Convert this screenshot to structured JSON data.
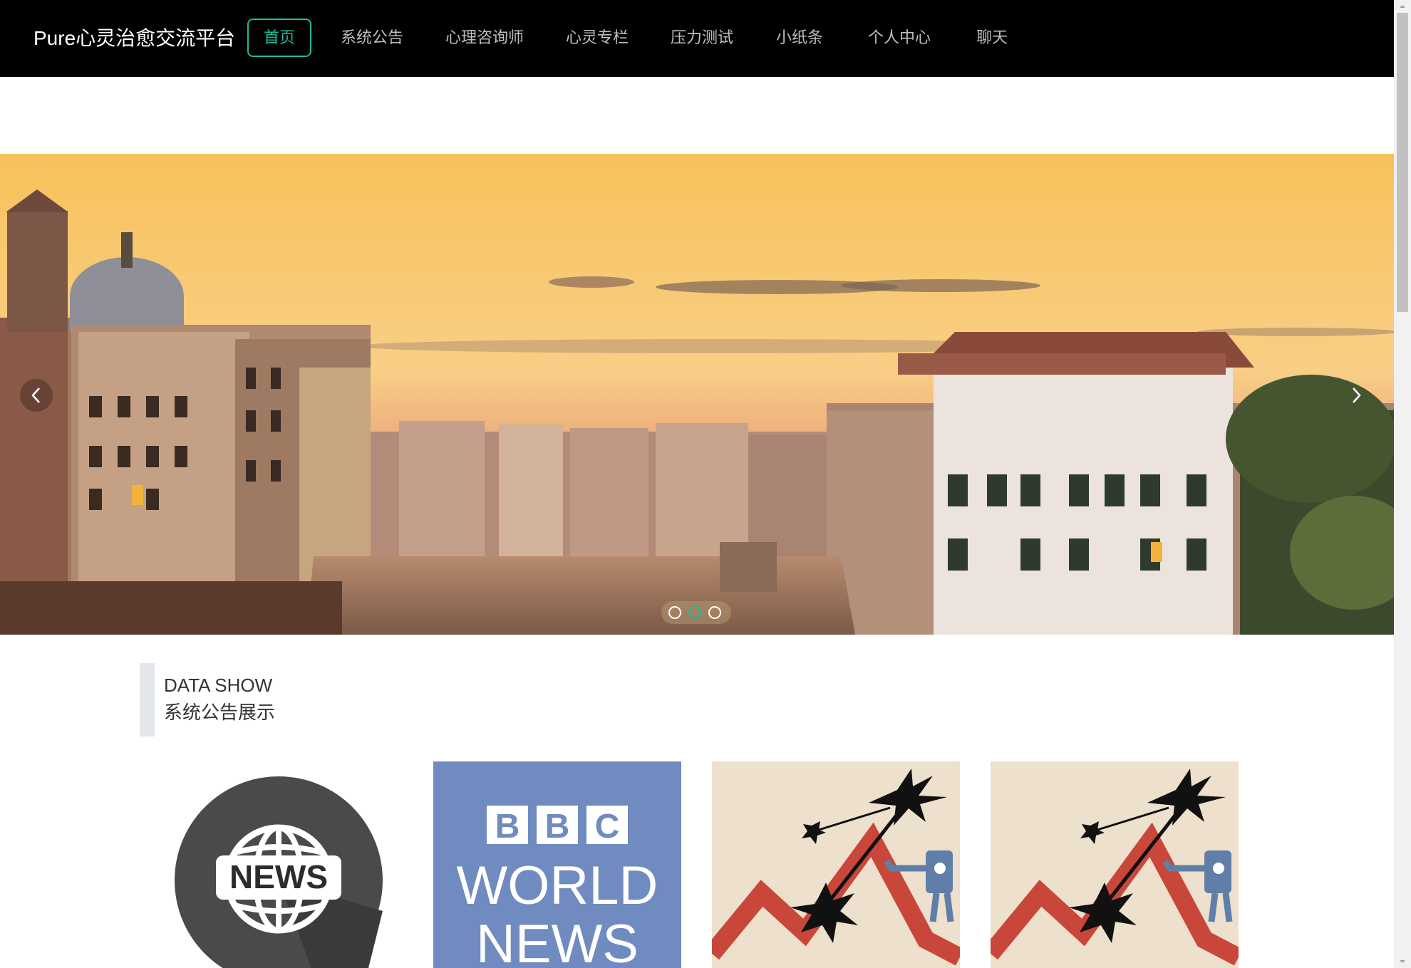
{
  "header": {
    "brand": "Pure心灵治愈交流平台",
    "nav": [
      {
        "label": "首页",
        "active": true
      },
      {
        "label": "系统公告"
      },
      {
        "label": "心理咨询师"
      },
      {
        "label": "心灵专栏"
      },
      {
        "label": "压力测试"
      },
      {
        "label": "小纸条"
      },
      {
        "label": "个人中心"
      },
      {
        "label": "聊天"
      }
    ]
  },
  "carousel": {
    "slide_count": 3,
    "active_index": 1,
    "prev_icon": "chevron-left-icon",
    "next_icon": "chevron-right-icon"
  },
  "section": {
    "title_en": "DATA SHOW",
    "title_cn": "系统公告展示"
  },
  "cards": [
    {
      "image": "news-globe-logo",
      "logo_text": "NEWS"
    },
    {
      "image": "bbc-world-news-logo",
      "logo_line1": "BBC",
      "logo_line2": "WORLD",
      "logo_line3": "NEWS"
    },
    {
      "image": "stock-crash-illustration"
    },
    {
      "image": "stock-crash-illustration"
    }
  ],
  "colors": {
    "accent": "#1abc9c",
    "topbar": "#000000",
    "nav_text": "#bfbfbf"
  }
}
